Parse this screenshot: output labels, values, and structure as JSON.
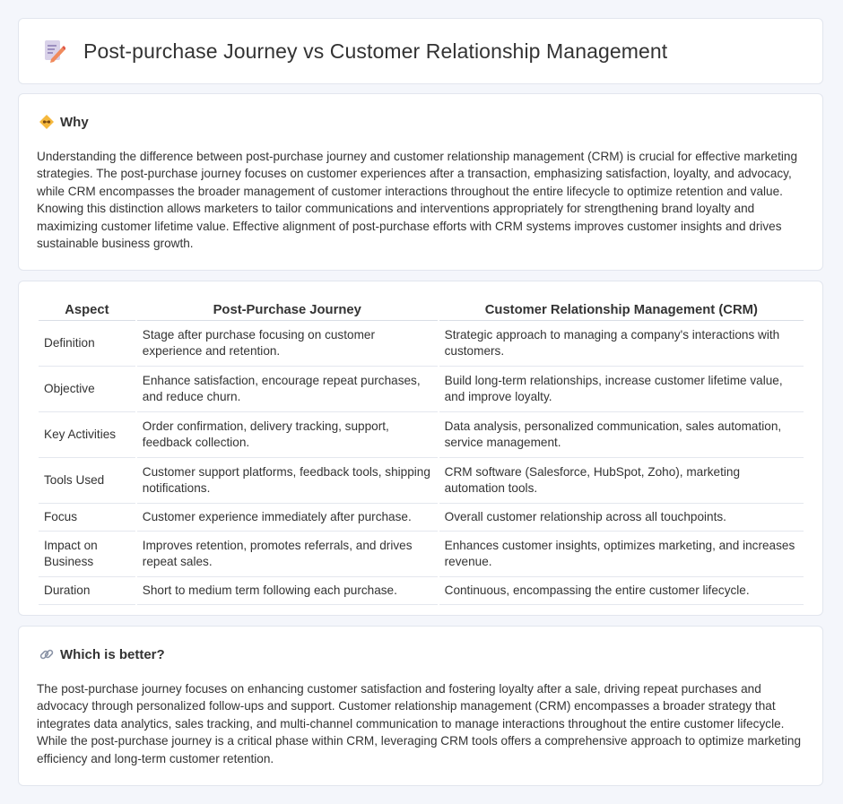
{
  "header": {
    "title": "Post-purchase Journey vs Customer Relationship Management",
    "icon": "document-edit-icon"
  },
  "why": {
    "heading": "Why",
    "icon": "handshake-icon",
    "text": "Understanding the difference between post-purchase journey and customer relationship management (CRM) is crucial for effective marketing strategies. The post-purchase journey focuses on customer experiences after a transaction, emphasizing satisfaction, loyalty, and advocacy, while CRM encompasses the broader management of customer interactions throughout the entire lifecycle to optimize retention and value. Knowing this distinction allows marketers to tailor communications and interventions appropriately for strengthening brand loyalty and maximizing customer lifetime value. Effective alignment of post-purchase efforts with CRM systems improves customer insights and drives sustainable business growth."
  },
  "table": {
    "headers": [
      "Aspect",
      "Post-Purchase Journey",
      "Customer Relationship Management (CRM)"
    ],
    "rows": [
      [
        "Definition",
        "Stage after purchase focusing on customer experience and retention.",
        "Strategic approach to managing a company's interactions with customers."
      ],
      [
        "Objective",
        "Enhance satisfaction, encourage repeat purchases, and reduce churn.",
        "Build long-term relationships, increase customer lifetime value, and improve loyalty."
      ],
      [
        "Key Activities",
        "Order confirmation, delivery tracking, support, feedback collection.",
        "Data analysis, personalized communication, sales automation, service management."
      ],
      [
        "Tools Used",
        "Customer support platforms, feedback tools, shipping notifications.",
        "CRM software (Salesforce, HubSpot, Zoho), marketing automation tools."
      ],
      [
        "Focus",
        "Customer experience immediately after purchase.",
        "Overall customer relationship across all touchpoints."
      ],
      [
        "Impact on Business",
        "Improves retention, promotes referrals, and drives repeat sales.",
        "Enhances customer insights, optimizes marketing, and increases revenue."
      ],
      [
        "Duration",
        "Short to medium term following each purchase.",
        "Continuous, encompassing the entire customer lifecycle."
      ]
    ]
  },
  "better": {
    "heading": "Which is better?",
    "icon": "link-icon",
    "text": "The post-purchase journey focuses on enhancing customer satisfaction and fostering loyalty after a sale, driving repeat purchases and advocacy through personalized follow-ups and support. Customer relationship management (CRM) encompasses a broader strategy that integrates data analytics, sales tracking, and multi-channel communication to manage interactions throughout the entire customer lifecycle. While the post-purchase journey is a critical phase within CRM, leveraging CRM tools offers a comprehensive approach to optimize marketing efficiency and long-term customer retention."
  }
}
